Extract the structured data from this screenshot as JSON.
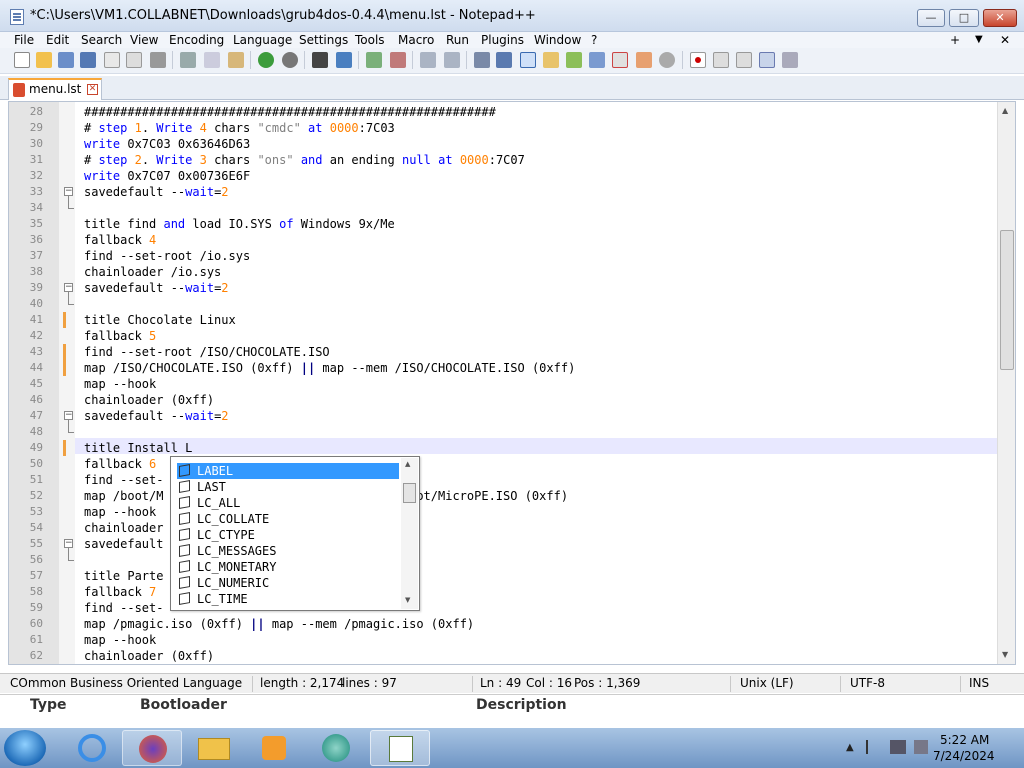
{
  "window": {
    "title": "*C:\\Users\\VM1.COLLABNET\\Downloads\\grub4dos-0.4.4\\menu.lst - Notepad++",
    "min_label": "—",
    "max_label": "□",
    "close_label": "✕"
  },
  "menu": [
    "File",
    "Edit",
    "Search",
    "View",
    "Encoding",
    "Language",
    "Settings",
    "Tools",
    "Macro",
    "Run",
    "Plugins",
    "Window",
    "?"
  ],
  "menu_right": [
    "+",
    "▼",
    "✕"
  ],
  "tab": {
    "label": "menu.lst",
    "close": "✕"
  },
  "editor": {
    "lines": [
      {
        "n": "28",
        "t": "#########################################################"
      },
      {
        "n": "29",
        "t": "# step 1. Write 4 chars \"cmdc\" at 0000:7C03"
      },
      {
        "n": "30",
        "t": "write 0x7C03 0x63646D63"
      },
      {
        "n": "31",
        "t": "# step 2. Write 3 chars \"ons\" and an ending null at 0000:7C07"
      },
      {
        "n": "32",
        "t": "write 0x7C07 0x00736E6F"
      },
      {
        "n": "33",
        "t": "savedefault --wait=2"
      },
      {
        "n": "34",
        "t": ""
      },
      {
        "n": "35",
        "t": "title find and load IO.SYS of Windows 9x/Me"
      },
      {
        "n": "36",
        "t": "fallback 4"
      },
      {
        "n": "37",
        "t": "find --set-root /io.sys"
      },
      {
        "n": "38",
        "t": "chainloader /io.sys"
      },
      {
        "n": "39",
        "t": "savedefault --wait=2"
      },
      {
        "n": "40",
        "t": ""
      },
      {
        "n": "41",
        "t": "title Chocolate Linux"
      },
      {
        "n": "42",
        "t": "fallback 5"
      },
      {
        "n": "43",
        "t": "find --set-root /ISO/CHOCOLATE.ISO"
      },
      {
        "n": "44",
        "t": "map /ISO/CHOCOLATE.ISO (0xff) || map --mem /ISO/CHOCOLATE.ISO (0xff)"
      },
      {
        "n": "45",
        "t": "map --hook"
      },
      {
        "n": "46",
        "t": "chainloader (0xff)"
      },
      {
        "n": "47",
        "t": "savedefault --wait=2"
      },
      {
        "n": "48",
        "t": ""
      },
      {
        "n": "49",
        "t": "title Install L"
      },
      {
        "n": "50",
        "t": "fallback 6"
      },
      {
        "n": "51",
        "t": "find --set-"
      },
      {
        "n": "52",
        "t": "map /boot/M                                /boot/MicroPE.ISO (0xff)"
      },
      {
        "n": "53",
        "t": "map --hook"
      },
      {
        "n": "54",
        "t": "chainloader"
      },
      {
        "n": "55",
        "t": "savedefault"
      },
      {
        "n": "56",
        "t": ""
      },
      {
        "n": "57",
        "t": "title Parte"
      },
      {
        "n": "58",
        "t": "fallback 7"
      },
      {
        "n": "59",
        "t": "find --set-"
      },
      {
        "n": "60",
        "t": "map /pmagic.iso (0xff) || map --mem /pmagic.iso (0xff)"
      },
      {
        "n": "61",
        "t": "map --hook"
      },
      {
        "n": "62",
        "t": "chainloader (0xff)"
      }
    ]
  },
  "autocomplete": {
    "items": [
      "LABEL",
      "LAST",
      "LC_ALL",
      "LC_COLLATE",
      "LC_CTYPE",
      "LC_MESSAGES",
      "LC_MONETARY",
      "LC_NUMERIC",
      "LC_TIME"
    ],
    "selected": "LABEL"
  },
  "status": {
    "language": "COmmon Business Oriented Language",
    "length": "length : 2,174",
    "lines": "lines : 97",
    "ln": "Ln : 49",
    "col": "Col : 16",
    "pos": "Pos : 1,369",
    "eol": "Unix (LF)",
    "encoding": "UTF-8",
    "mode": "INS"
  },
  "behind": {
    "col1": "Type",
    "col2": "Bootloader",
    "col3": "Description"
  },
  "taskbar": {
    "time": "5:22 AM",
    "date": "7/24/2024"
  },
  "colors": {
    "keyword": "#0000ff",
    "number": "#ff8000",
    "string": "#808080",
    "selection": "#3399ff"
  }
}
